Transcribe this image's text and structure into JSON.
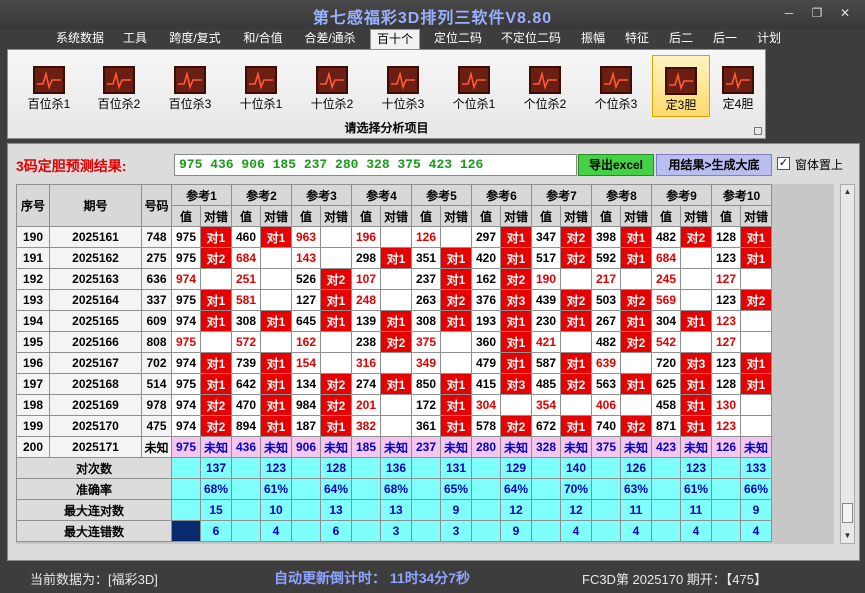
{
  "window": {
    "title": "第七感福彩3D排列三软件V8.80",
    "minimize": "─",
    "restore": "❐",
    "close": "✕"
  },
  "menu": [
    "系统数据",
    "工具",
    "跨度/复式",
    "和/合值",
    "合差/通杀",
    "百十个",
    "定位二码",
    "不定位二码",
    "振幅",
    "特征",
    "后二",
    "后一",
    "计划"
  ],
  "ribbon": {
    "buttons": [
      "百位杀1",
      "百位杀2",
      "百位杀3",
      "十位杀1",
      "十位杀2",
      "十位杀3",
      "个位杀1",
      "个位杀2",
      "个位杀3",
      "定3胆",
      "定4胆"
    ],
    "caption": "请选择分析项目"
  },
  "prediction": {
    "label": "3码定胆预测结果:",
    "values": "975 436 906 185 237 280 328 375 423 126",
    "export_label": "导出excel",
    "apply_label": "用结果>生成大底",
    "ontop_label": "窗体置上",
    "ontop_checked": "✓"
  },
  "table": {
    "h_seq": "序号",
    "h_period": "期号",
    "h_number": "号码",
    "refs": [
      "参考1",
      "参考2",
      "参考3",
      "参考4",
      "参考5",
      "参考6",
      "参考7",
      "参考8",
      "参考9",
      "参考10"
    ],
    "sub_value": "值",
    "sub_mark": "对错",
    "rows": [
      {
        "seq": "190",
        "period": "2025161",
        "number": "748",
        "cells": [
          [
            "975",
            "对1"
          ],
          [
            "460",
            "对1"
          ],
          [
            "963",
            ""
          ],
          [
            "196",
            ""
          ],
          [
            "126",
            ""
          ],
          [
            "297",
            "对1"
          ],
          [
            "347",
            "对2"
          ],
          [
            "398",
            "对1"
          ],
          [
            "482",
            "对2"
          ],
          [
            "128",
            "对1"
          ]
        ]
      },
      {
        "seq": "191",
        "period": "2025162",
        "number": "275",
        "cells": [
          [
            "975",
            "对2"
          ],
          [
            "684",
            ""
          ],
          [
            "143",
            ""
          ],
          [
            "298",
            "对1"
          ],
          [
            "351",
            "对1"
          ],
          [
            "420",
            "对1"
          ],
          [
            "517",
            "对2"
          ],
          [
            "592",
            "对1"
          ],
          [
            "684",
            ""
          ],
          [
            "123",
            "对1"
          ]
        ]
      },
      {
        "seq": "192",
        "period": "2025163",
        "number": "636",
        "cells": [
          [
            "974",
            ""
          ],
          [
            "251",
            ""
          ],
          [
            "526",
            "对2"
          ],
          [
            "107",
            ""
          ],
          [
            "237",
            "对1"
          ],
          [
            "162",
            "对2"
          ],
          [
            "190",
            ""
          ],
          [
            "217",
            ""
          ],
          [
            "245",
            ""
          ],
          [
            "127",
            ""
          ]
        ]
      },
      {
        "seq": "193",
        "period": "2025164",
        "number": "337",
        "cells": [
          [
            "975",
            "对1"
          ],
          [
            "581",
            ""
          ],
          [
            "127",
            "对1"
          ],
          [
            "248",
            ""
          ],
          [
            "263",
            "对2"
          ],
          [
            "376",
            "对3"
          ],
          [
            "439",
            "对2"
          ],
          [
            "503",
            "对2"
          ],
          [
            "569",
            ""
          ],
          [
            "123",
            "对2"
          ]
        ]
      },
      {
        "seq": "194",
        "period": "2025165",
        "number": "609",
        "cells": [
          [
            "974",
            "对1"
          ],
          [
            "308",
            "对1"
          ],
          [
            "645",
            "对1"
          ],
          [
            "139",
            "对1"
          ],
          [
            "308",
            "对1"
          ],
          [
            "193",
            "对1"
          ],
          [
            "230",
            "对1"
          ],
          [
            "267",
            "对1"
          ],
          [
            "304",
            "对1"
          ],
          [
            "123",
            ""
          ]
        ]
      },
      {
        "seq": "195",
        "period": "2025166",
        "number": "808",
        "cells": [
          [
            "975",
            ""
          ],
          [
            "572",
            ""
          ],
          [
            "162",
            ""
          ],
          [
            "238",
            "对2"
          ],
          [
            "375",
            ""
          ],
          [
            "360",
            "对1"
          ],
          [
            "421",
            ""
          ],
          [
            "482",
            "对2"
          ],
          [
            "542",
            ""
          ],
          [
            "127",
            ""
          ]
        ]
      },
      {
        "seq": "196",
        "period": "2025167",
        "number": "702",
        "cells": [
          [
            "974",
            "对1"
          ],
          [
            "739",
            "对1"
          ],
          [
            "154",
            ""
          ],
          [
            "316",
            ""
          ],
          [
            "349",
            ""
          ],
          [
            "479",
            "对1"
          ],
          [
            "587",
            "对1"
          ],
          [
            "639",
            ""
          ],
          [
            "720",
            "对3"
          ],
          [
            "123",
            "对1"
          ]
        ]
      },
      {
        "seq": "197",
        "period": "2025168",
        "number": "514",
        "cells": [
          [
            "975",
            "对1"
          ],
          [
            "642",
            "对1"
          ],
          [
            "134",
            "对2"
          ],
          [
            "274",
            "对1"
          ],
          [
            "850",
            "对1"
          ],
          [
            "415",
            "对3"
          ],
          [
            "485",
            "对2"
          ],
          [
            "563",
            "对1"
          ],
          [
            "625",
            "对1"
          ],
          [
            "128",
            "对1"
          ]
        ]
      },
      {
        "seq": "198",
        "period": "2025169",
        "number": "978",
        "cells": [
          [
            "974",
            "对2"
          ],
          [
            "470",
            "对1"
          ],
          [
            "984",
            "对2"
          ],
          [
            "201",
            ""
          ],
          [
            "172",
            "对1"
          ],
          [
            "304",
            ""
          ],
          [
            "354",
            ""
          ],
          [
            "406",
            ""
          ],
          [
            "458",
            "对1"
          ],
          [
            "130",
            ""
          ]
        ]
      },
      {
        "seq": "199",
        "period": "2025170",
        "number": "475",
        "cells": [
          [
            "974",
            "对2"
          ],
          [
            "894",
            "对1"
          ],
          [
            "187",
            "对1"
          ],
          [
            "382",
            ""
          ],
          [
            "361",
            "对1"
          ],
          [
            "578",
            "对2"
          ],
          [
            "672",
            "对1"
          ],
          [
            "740",
            "对2"
          ],
          [
            "871",
            "对1"
          ],
          [
            "123",
            ""
          ]
        ]
      }
    ],
    "pending": {
      "seq": "200",
      "period": "2025171",
      "number": "未知",
      "values": [
        "975",
        "436",
        "906",
        "185",
        "237",
        "280",
        "328",
        "375",
        "423",
        "126"
      ],
      "mark": "未知"
    },
    "stats": [
      {
        "label": "对次数",
        "values": [
          "137",
          "123",
          "128",
          "136",
          "131",
          "129",
          "140",
          "126",
          "123",
          "133"
        ]
      },
      {
        "label": "准确率",
        "values": [
          "68%",
          "61%",
          "64%",
          "68%",
          "65%",
          "64%",
          "70%",
          "63%",
          "61%",
          "66%"
        ]
      },
      {
        "label": "最大连对数",
        "values": [
          "15",
          "10",
          "13",
          "13",
          "9",
          "12",
          "12",
          "11",
          "11",
          "9"
        ]
      },
      {
        "label": "最大连错数",
        "values": [
          "6",
          "4",
          "6",
          "3",
          "3",
          "9",
          "4",
          "4",
          "4",
          "4"
        ]
      }
    ]
  },
  "status": {
    "source": "当前数据为：[福彩3D]",
    "countdown": "自动更新倒计时：  11时34分7秒",
    "draw": "FC3D第 2025170 期开：【475】"
  },
  "colors": {
    "hit": "#e60000",
    "stat_bg": "#80ffff",
    "pending_bg": "#f7c6ee",
    "title": "#9ab0ff"
  }
}
